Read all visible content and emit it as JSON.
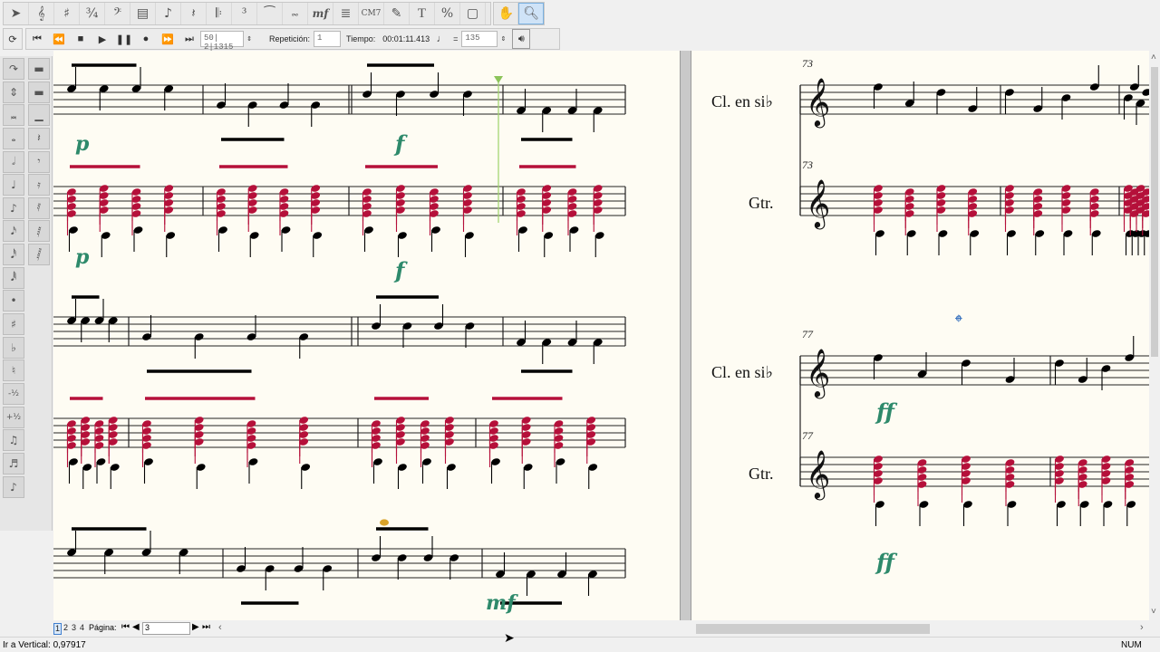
{
  "toolbar": {
    "note_tools": [
      "select-arrow",
      "treble-clef",
      "key-signature",
      "time-signature",
      "bass-clef",
      "measure",
      "note-entry",
      "rest",
      "bar-repeat",
      "tuplet",
      "slur",
      "ornament",
      "dynamics",
      "lyric",
      "chord",
      "articulation",
      "text",
      "percent",
      "staff-style"
    ],
    "view_tools": [
      "hand",
      "zoom"
    ],
    "dynamic_label": "mf",
    "chord_label": "CM7",
    "text_label": "T"
  },
  "playback": {
    "position": "50| 2|1315",
    "repeat_label": "Repetición:",
    "repeat_value": "1",
    "time_label": "Tiempo:",
    "time_value": "00:01:11.413",
    "tempo_equals": "=",
    "tempo_value": "135"
  },
  "score": {
    "left_page": {
      "systems": [
        {
          "dynamics": [
            "p",
            "f"
          ]
        },
        {
          "dynamics": [
            "p",
            "f"
          ]
        },
        {
          "dynamics": []
        },
        {
          "dynamics": []
        },
        {
          "dynamics": [
            "mf"
          ]
        }
      ]
    },
    "right_page": {
      "systems": [
        {
          "measure_number": "73",
          "staff1_name": "Cl. en si♭",
          "staff2_name": "Gtr.",
          "staff1_measure": "73",
          "staff2_measure": "73"
        },
        {
          "measure_number": "77",
          "staff1_name": "Cl. en si♭",
          "staff2_name": "Gtr.",
          "coda": "𝄌",
          "dynamics": [
            "ff",
            "ff"
          ],
          "staff1_measure": "77",
          "staff2_measure": "77"
        }
      ]
    },
    "colors": {
      "melody": "#000000",
      "guitar_upper": "#b5103a",
      "dynamics": "#2e8a6b",
      "selected_note": "#d9a32a",
      "page_bg": "#fefcf3"
    }
  },
  "page_nav": {
    "pages": [
      "1",
      "2",
      "3",
      "4"
    ],
    "active_page": "1",
    "label": "Página:",
    "value": "3"
  },
  "status": {
    "text": "Ir a Vertical: 0,97917",
    "num": "NUM"
  }
}
